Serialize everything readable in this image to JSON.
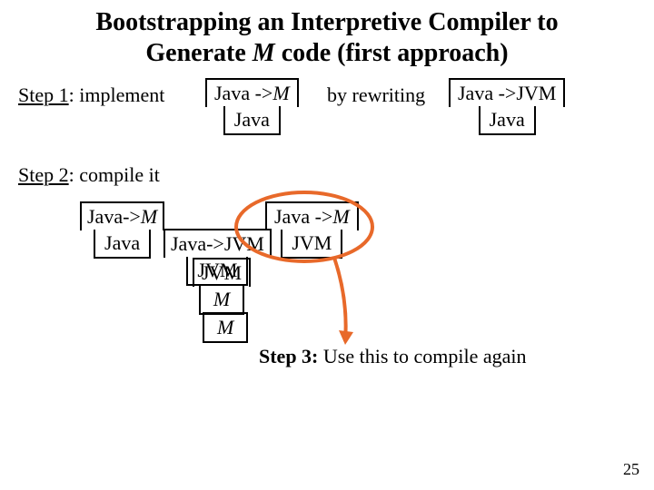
{
  "title_line1": "Bootstrapping an Interpretive Compiler to",
  "title_line2_a": "Generate ",
  "title_line2_m": "M",
  "title_line2_b": " code (first approach)",
  "step1_prefix": "Step 1",
  "step1_rest": ": implement",
  "step1_mid": "by rewriting",
  "t1": {
    "top_a": "Java ->",
    "top_m": "M",
    "bot": "Java"
  },
  "t2": {
    "top": "Java ->JVM",
    "bot": "Java"
  },
  "step2_prefix": "Step 2",
  "step2_rest": ": compile it",
  "s2a": {
    "top_a": "Java->",
    "top_m": "M",
    "bot": "Java"
  },
  "s2b": {
    "top": "Java->JVM",
    "bot": "JVM"
  },
  "s2c": {
    "top_a": "Java ->",
    "top_m": "M",
    "bot": "JVM"
  },
  "s2d": {
    "top": "JVM",
    "bot_m": "M"
  },
  "s2e": {
    "m": "M"
  },
  "step3_prefix": "Step 3:",
  "step3_rest": " Use this to compile again",
  "page": "25"
}
